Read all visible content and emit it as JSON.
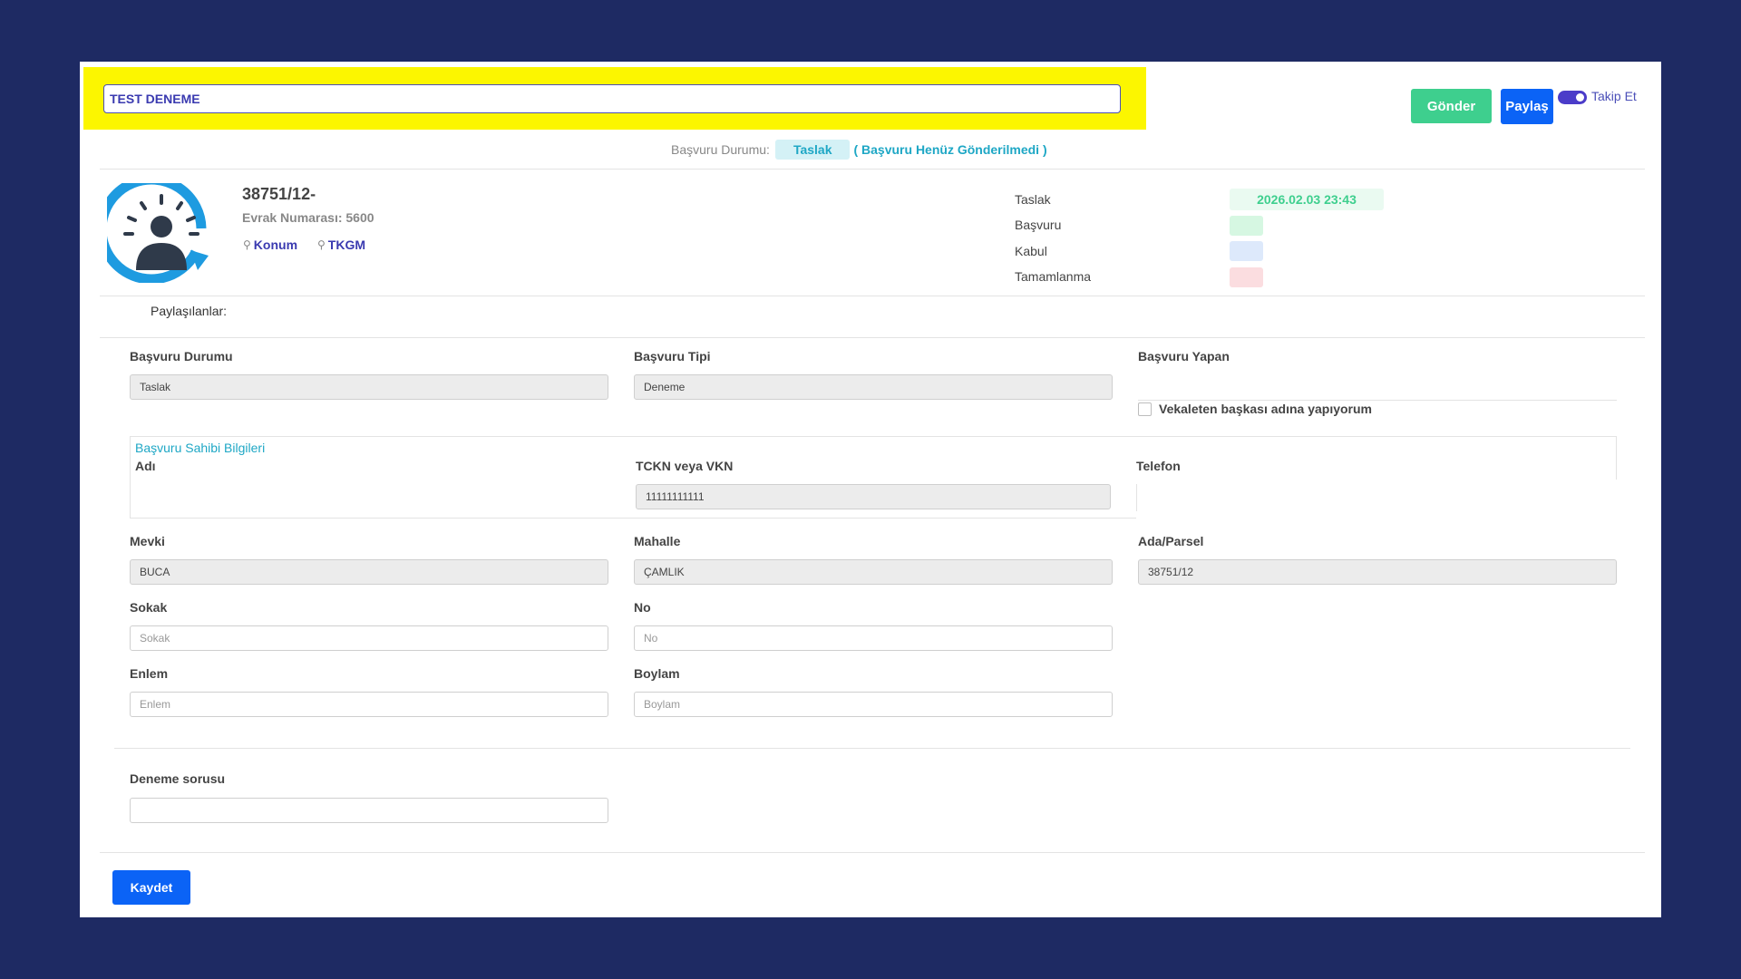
{
  "header": {
    "title_value": "TEST DENEME",
    "send_label": "Gönder",
    "share_label": "Paylaş",
    "follow_label": "Takip Et",
    "follow_on": true
  },
  "status": {
    "label": "Başvuru Durumu:",
    "badge": "Taslak",
    "note": "( Başvuru Henüz Gönderilmedi )"
  },
  "record": {
    "number": "38751/12-",
    "evrak_label": "Evrak Numarası: 5600",
    "konum_link": "Konum",
    "tkgm_link": "TKGM"
  },
  "stages": [
    {
      "label": "Taslak",
      "value": "2026.02.03 23:43",
      "color": "#eafaf1"
    },
    {
      "label": "Başvuru",
      "value": "",
      "color": "#d6f7e2"
    },
    {
      "label": "Kabul",
      "value": "",
      "color": "#dde9fb"
    },
    {
      "label": "Tamamlanma",
      "value": "",
      "color": "#fbdde0"
    }
  ],
  "shared_label": "Paylaşılanlar:",
  "form": {
    "basvuru_durumu": {
      "label": "Başvuru Durumu",
      "value": "Taslak"
    },
    "basvuru_tipi": {
      "label": "Başvuru Tipi",
      "value": "Deneme"
    },
    "basvuru_yapan": {
      "label": "Başvuru Yapan",
      "checkbox_label": "Vekaleten başkası adına yapıyorum"
    },
    "owner_section": "Başvuru Sahibi Bilgileri",
    "adi": {
      "label": "Adı"
    },
    "tckn": {
      "label": "TCKN veya VKN",
      "value": "11111111111"
    },
    "telefon": {
      "label": "Telefon"
    },
    "mevki": {
      "label": "Mevki",
      "value": "BUCA"
    },
    "mahalle": {
      "label": "Mahalle",
      "value": "ÇAMLIK"
    },
    "ada_parsel": {
      "label": "Ada/Parsel",
      "value": "38751/12"
    },
    "sokak": {
      "label": "Sokak",
      "placeholder": "Sokak"
    },
    "no": {
      "label": "No",
      "placeholder": "No"
    },
    "enlem": {
      "label": "Enlem",
      "placeholder": "Enlem"
    },
    "boylam": {
      "label": "Boylam",
      "placeholder": "Boylam"
    },
    "deneme_sorusu": {
      "label": "Deneme sorusu",
      "value": ""
    }
  },
  "save_label": "Kaydet",
  "colors": {
    "background": "#1e2a63",
    "highlight": "#fcf600",
    "primary": "#0b63f6",
    "success": "#3ecf8e",
    "accent": "#1ea7c5",
    "toggle": "#4b3cc9"
  }
}
